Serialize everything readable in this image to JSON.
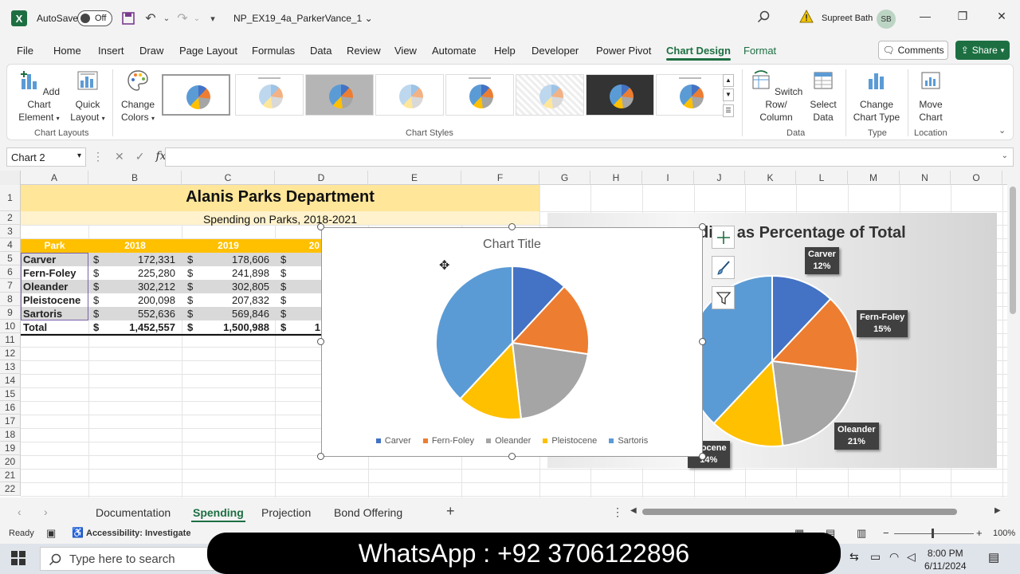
{
  "titlebar": {
    "autosave_label": "AutoSave",
    "autosave_state": "Off",
    "filename": "NP_EX19_4a_ParkerVance_1",
    "user_name": "Supreet Bath",
    "avatar_initials": "SB"
  },
  "ribbon_tabs": [
    "File",
    "Home",
    "Insert",
    "Draw",
    "Page Layout",
    "Formulas",
    "Data",
    "Review",
    "View",
    "Automate",
    "Help",
    "Developer",
    "Power Pivot",
    "Chart Design",
    "Format"
  ],
  "active_tab": "Chart Design",
  "comments_label": "Comments",
  "share_label": "Share",
  "ribbon": {
    "add_chart_element": "Add Chart Element",
    "quick_layout": "Quick Layout",
    "change_colors": "Change Colors",
    "chart_layouts_label": "Chart Layouts",
    "chart_styles_label": "Chart Styles",
    "switch_row_column": "Switch Row/ Column",
    "select_data": "Select Data",
    "data_label": "Data",
    "change_chart_type": "Change Chart Type",
    "type_label": "Type",
    "move_chart": "Move Chart",
    "location_label": "Location"
  },
  "name_box": "Chart 2",
  "columns": [
    "A",
    "B",
    "C",
    "D",
    "E",
    "F",
    "G",
    "H",
    "I",
    "J",
    "K",
    "L",
    "M",
    "N",
    "O"
  ],
  "rows": [
    "1",
    "2",
    "3",
    "4",
    "5",
    "6",
    "7",
    "8",
    "9",
    "10",
    "11",
    "12",
    "13",
    "14",
    "15",
    "16",
    "17",
    "18",
    "19",
    "20",
    "21",
    "22"
  ],
  "sheet": {
    "title": "Alanis Parks Department",
    "subtitle": "Spending on Parks, 2018-2021",
    "header_park": "Park",
    "header_2018": "2018",
    "header_2019": "2019",
    "header_d_partial": "20",
    "currency": "$",
    "parks": [
      {
        "name": "Carver",
        "y2018": "172,331",
        "y2019": "178,606"
      },
      {
        "name": "Fern-Foley",
        "y2018": "225,280",
        "y2019": "241,898"
      },
      {
        "name": "Oleander",
        "y2018": "302,212",
        "y2019": "302,805"
      },
      {
        "name": "Pleistocene",
        "y2018": "200,098",
        "y2019": "207,832"
      },
      {
        "name": "Sartoris",
        "y2018": "552,636",
        "y2019": "569,846"
      }
    ],
    "total": {
      "name": "Total",
      "y2018": "1,452,557",
      "y2019": "1,500,988",
      "d_partial": "1"
    }
  },
  "chart_data": [
    {
      "type": "pie",
      "title": "Chart Title",
      "categories": [
        "Carver",
        "Fern-Foley",
        "Oleander",
        "Pleistocene",
        "Sartoris"
      ],
      "values": [
        172331,
        225280,
        302212,
        200098,
        552636
      ],
      "colors": [
        "#4472c4",
        "#ed7d31",
        "#a5a5a5",
        "#ffc000",
        "#5b9bd5"
      ],
      "legend": "bottom"
    },
    {
      "type": "pie",
      "title_partial": "ding as Percentage of Total",
      "categories": [
        "Carver",
        "Fern-Foley",
        "Oleander",
        "Pleistocene",
        "Sartoris"
      ],
      "labels": [
        "Carver\n12%",
        "Fern-Foley\n15%",
        "Oleander\n21%",
        "istocene\n14%"
      ],
      "percents": [
        12,
        15,
        21,
        14,
        38
      ],
      "colors": [
        "#4472c4",
        "#ed7d31",
        "#a5a5a5",
        "#ffc000",
        "#5b9bd5"
      ]
    }
  ],
  "sheet_tabs": [
    "Documentation",
    "Spending",
    "Projection",
    "Bond Offering"
  ],
  "active_sheet": "Spending",
  "status": {
    "ready": "Ready",
    "accessibility": "Accessibility: Investigate",
    "zoom": "100%"
  },
  "taskbar": {
    "search_placeholder": "Type here to search",
    "time": "8:00 PM",
    "date": "6/11/2024"
  },
  "banner": "WhatsApp : +92 3706122896"
}
